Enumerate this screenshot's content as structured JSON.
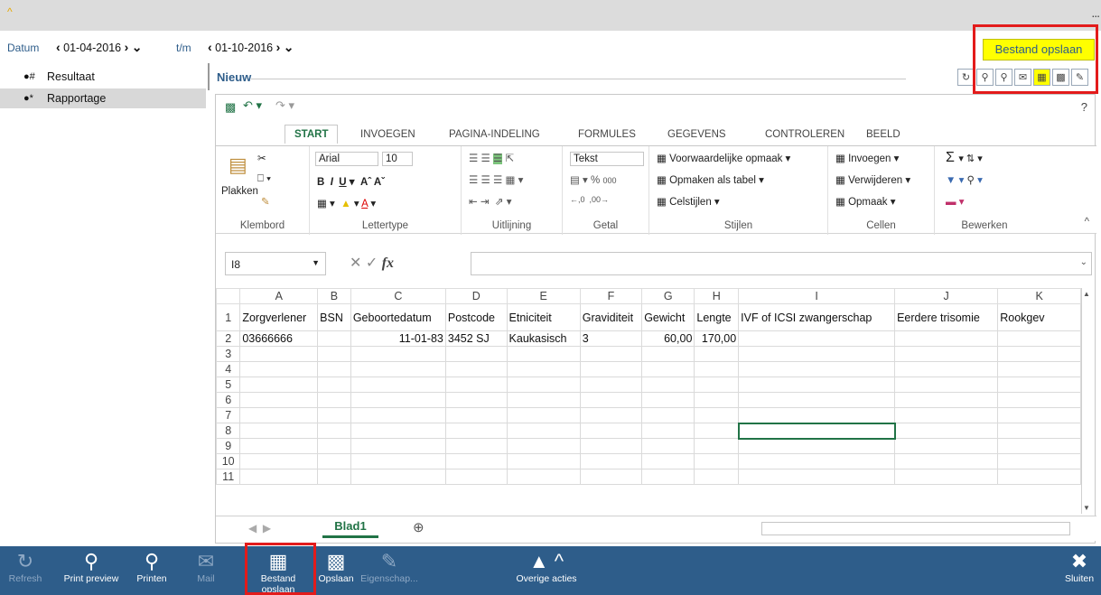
{
  "datebar": {
    "label_from": "Datum",
    "from": "01-04-2016",
    "label_to": "t/m",
    "to": "01-10-2016"
  },
  "tree": [
    {
      "label": "Resultaat",
      "icon": "#"
    },
    {
      "label": "Rapportage",
      "icon": "*"
    }
  ],
  "main": {
    "title": "Nieuw",
    "tooltip": "Bestand opslaan"
  },
  "excel": {
    "tabs": [
      "START",
      "INVOEGEN",
      "PAGINA-INDELING",
      "FORMULES",
      "GEGEVENS",
      "CONTROLEREN",
      "BEELD"
    ],
    "groups": [
      "Klembord",
      "Lettertype",
      "Uitlijning",
      "Getal",
      "Stijlen",
      "Cellen",
      "Bewerken"
    ],
    "paste": "Plakken",
    "font": "Arial",
    "size": "10",
    "numformat": "Tekst",
    "styles": [
      "Voorwaardelijke opmaak",
      "Opmaken als tabel",
      "Celstijlen"
    ],
    "cells": [
      "Invoegen",
      "Verwijderen",
      "Opmaak"
    ],
    "namebox": "I8",
    "columns": [
      "A",
      "B",
      "C",
      "D",
      "E",
      "F",
      "G",
      "H",
      "I",
      "J",
      "K"
    ],
    "row1": [
      "Zorgverlener",
      "BSN",
      "Geboortedatum",
      "Postcode",
      "Etniciteit",
      "Graviditeit",
      "Gewicht",
      "Lengte",
      "IVF of ICSI zwangerschap",
      "Eerdere trisomie",
      "Rookgev"
    ],
    "row2": [
      "03666666",
      "",
      "11-01-83",
      "3452 SJ",
      "Kaukasisch",
      "3",
      "60,00",
      "170,00",
      "",
      "",
      ""
    ],
    "sheet": "Blad1"
  },
  "bottom": [
    {
      "label": "Refresh",
      "disabled": true
    },
    {
      "label": "Print preview",
      "disabled": false
    },
    {
      "label": "Printen",
      "disabled": false
    },
    {
      "label": "Mail",
      "disabled": true
    },
    {
      "label": "Bestand opslaan",
      "disabled": false
    },
    {
      "label": "Opslaan",
      "disabled": false
    },
    {
      "label": "Eigenschap...",
      "disabled": true
    },
    {
      "label": "Overige acties",
      "disabled": false
    },
    {
      "label": "Sluiten",
      "disabled": false
    }
  ]
}
